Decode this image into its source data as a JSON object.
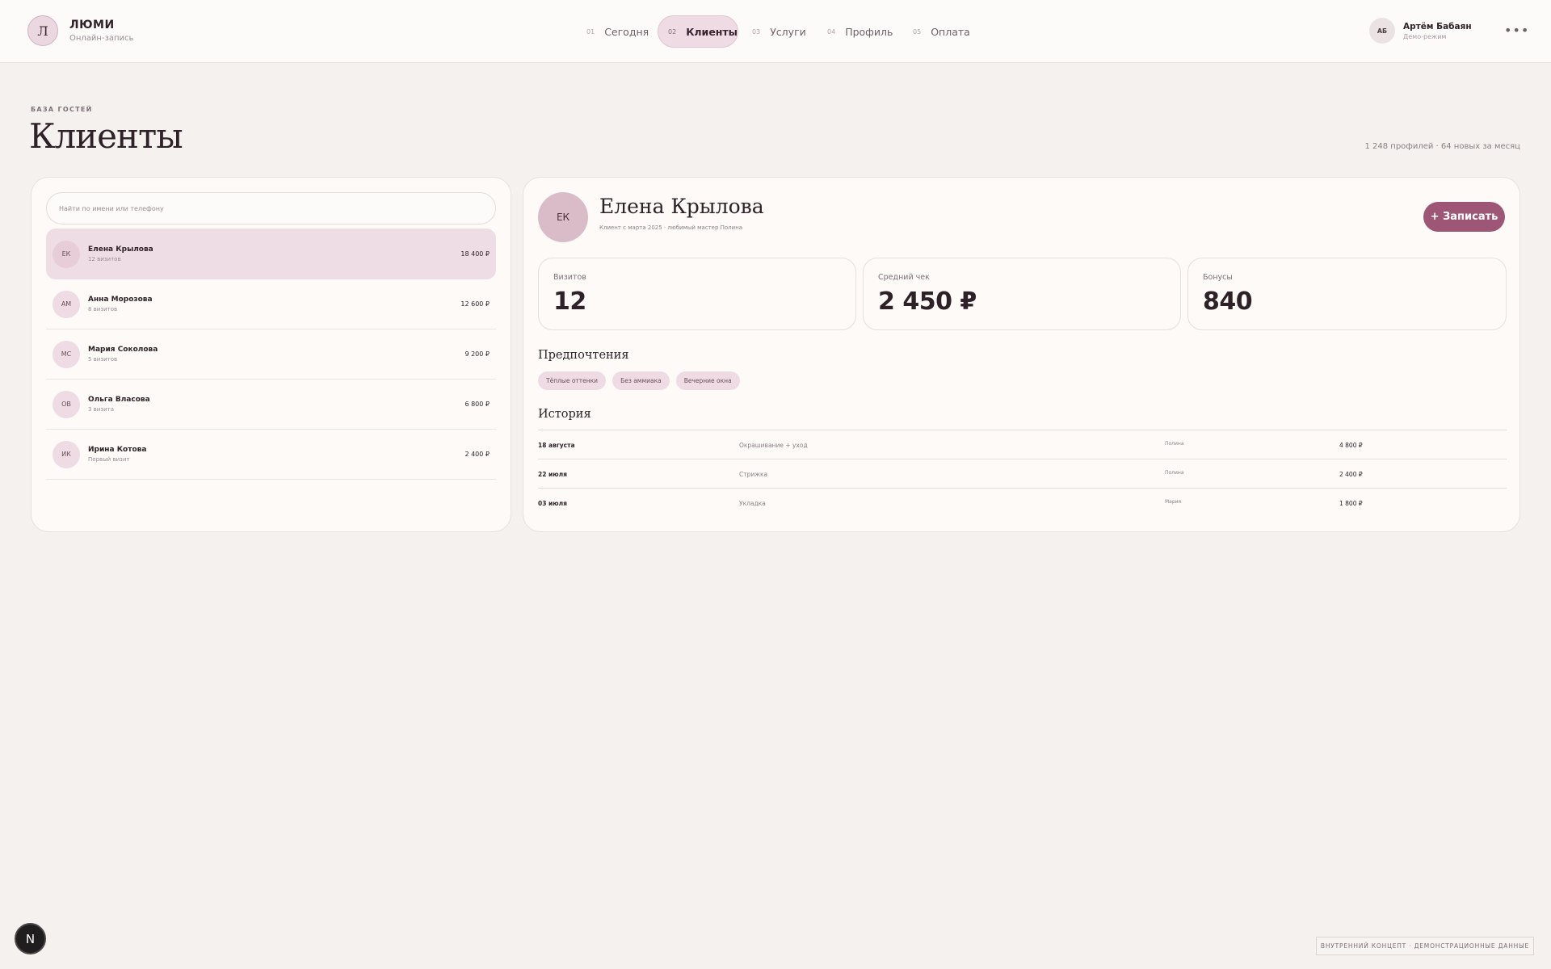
{
  "brand": {
    "mark": "Л",
    "name": "ЛЮМИ",
    "subtitle": "Онлайн-запись"
  },
  "nav": [
    {
      "num": "01",
      "label": "Сегодня",
      "active": false
    },
    {
      "num": "02",
      "label": "Клиенты",
      "active": true
    },
    {
      "num": "03",
      "label": "Услуги",
      "active": false
    },
    {
      "num": "04",
      "label": "Профиль",
      "active": false
    },
    {
      "num": "05",
      "label": "Оплата",
      "active": false
    }
  ],
  "user": {
    "initials": "АБ",
    "name": "Артём Бабаян",
    "mode": "Демо-режим",
    "more_icon": "more-dots-icon"
  },
  "page": {
    "eyebrow": "БАЗА ГОСТЕЙ",
    "title": "Клиенты",
    "stats": "1 248 профилей · 64 новых за месяц"
  },
  "search": {
    "placeholder": "Найти по имени или телефону",
    "value": ""
  },
  "clients": [
    {
      "initials": "ЕК",
      "name": "Елена Крылова",
      "visits": "12 визитов",
      "amount": "18 400 ₽",
      "active": true
    },
    {
      "initials": "АМ",
      "name": "Анна Морозова",
      "visits": "8 визитов",
      "amount": "12 600 ₽",
      "active": false
    },
    {
      "initials": "МС",
      "name": "Мария Соколова",
      "visits": "5 визитов",
      "amount": "9 200 ₽",
      "active": false
    },
    {
      "initials": "ОВ",
      "name": "Ольга Власова",
      "visits": "3 визита",
      "amount": "6 800 ₽",
      "active": false
    },
    {
      "initials": "ИК",
      "name": "Ирина Котова",
      "visits": "Первый визит",
      "amount": "2 400 ₽",
      "active": false
    }
  ],
  "profile": {
    "initials": "ЕК",
    "name": "Елена Крылова",
    "subtitle": "Клиент с марта 2025 · любимый мастер Полина",
    "book_label": "+ Записать",
    "stats": [
      {
        "label": "Визитов",
        "value": "12"
      },
      {
        "label": "Средний чек",
        "value": "2 450 ₽"
      },
      {
        "label": "Бонусы",
        "value": "840"
      }
    ],
    "preferences_title": "Предпочтения",
    "preferences": [
      "Тёплые оттенки",
      "Без аммиака",
      "Вечерние окна"
    ],
    "history_title": "История",
    "history": [
      {
        "date": "18 августа",
        "service": "Окрашивание + уход",
        "master": "Полина",
        "amount": "4 800 ₽"
      },
      {
        "date": "22 июля",
        "service": "Стрижка",
        "master": "Полина",
        "amount": "2 400 ₽"
      },
      {
        "date": "03 июля",
        "service": "Укладка",
        "master": "Мария",
        "amount": "1 800 ₽"
      }
    ]
  },
  "footer": {
    "badge": "N",
    "note": "ВНУТРЕННИЙ КОНЦЕПТ · ДЕМОНСТРАЦИОННЫЕ ДАННЫЕ"
  },
  "colors": {
    "accent": "#9d5676",
    "accent_soft": "#eedbe3",
    "background": "#f4f1ee",
    "panel": "#fdfaf8"
  }
}
